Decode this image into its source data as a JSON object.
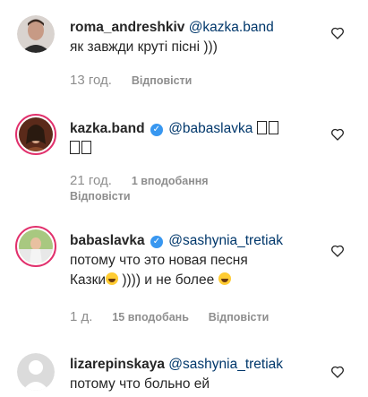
{
  "comments": [
    {
      "username": "roma_andreshkiv",
      "mention": "@kazka.band",
      "text_line2": "як завжди круті пісні )))",
      "time": "13 год.",
      "reply": "Відповісти"
    },
    {
      "username": "kazka.band",
      "mention": "@babaslavka",
      "time": "21 год.",
      "likes": "1 вподобання",
      "reply": "Відповісти"
    },
    {
      "username": "babaslavka",
      "mention": "@sashynia_tretiak",
      "text_line2": "потому что это новая песня",
      "text_line3a": "Казки",
      "text_line3b": " )))) и не более ",
      "time": "1 д.",
      "likes": "15 вподобань",
      "reply": "Відповісти"
    },
    {
      "username": "lizarepinskaya",
      "mention": "@sashynia_tretiak",
      "text_line2": "потому что больно ей"
    }
  ],
  "colors": {
    "mention": "#00376b",
    "muted": "#8e8e8e",
    "verified": "#3897f0",
    "story_ring": "#e1306c"
  },
  "icons": [
    "heart-outline-icon",
    "verified-badge-icon",
    "grinning-emoji-icon",
    "missing-glyph-box"
  ]
}
